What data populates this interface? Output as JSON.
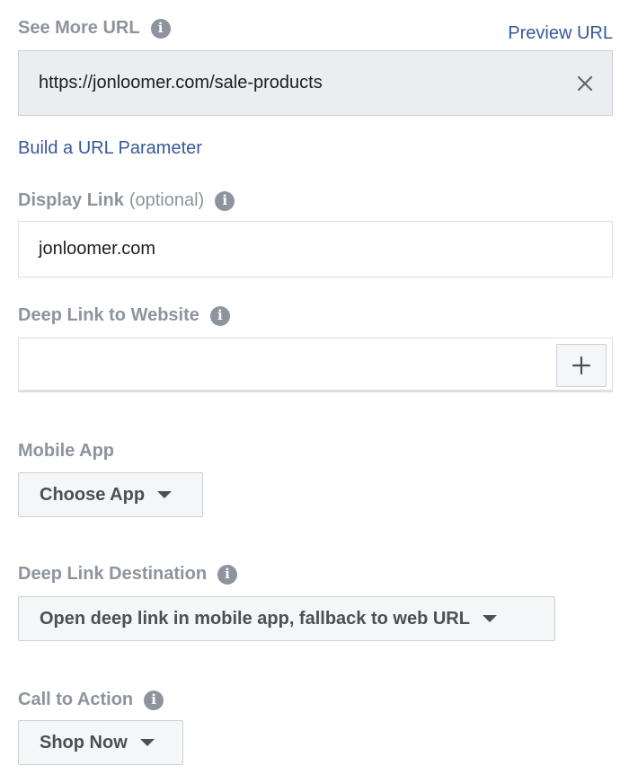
{
  "see_more_url": {
    "label": "See More URL",
    "info_icon": "info-icon",
    "preview_link": "Preview URL",
    "value": "https://jonloomer.com/sale-products",
    "clear_icon": "close-icon"
  },
  "build_url_parameter": "Build a URL Parameter",
  "display_link": {
    "label": "Display Link",
    "optional": "(optional)",
    "value": "jonloomer.com"
  },
  "deep_link_website": {
    "label": "Deep Link to Website",
    "value": "",
    "add_icon": "plus-icon"
  },
  "mobile_app": {
    "label": "Mobile App",
    "selected": "Choose App"
  },
  "deep_link_destination": {
    "label": "Deep Link Destination",
    "selected": "Open deep link in mobile app, fallback to web URL"
  },
  "call_to_action": {
    "label": "Call to Action",
    "selected": "Shop Now"
  },
  "colors": {
    "label_gray": "#8d949e",
    "link_blue": "#385898",
    "disabled_field_bg": "#ebedf0",
    "button_bg": "#f5f6f7"
  }
}
